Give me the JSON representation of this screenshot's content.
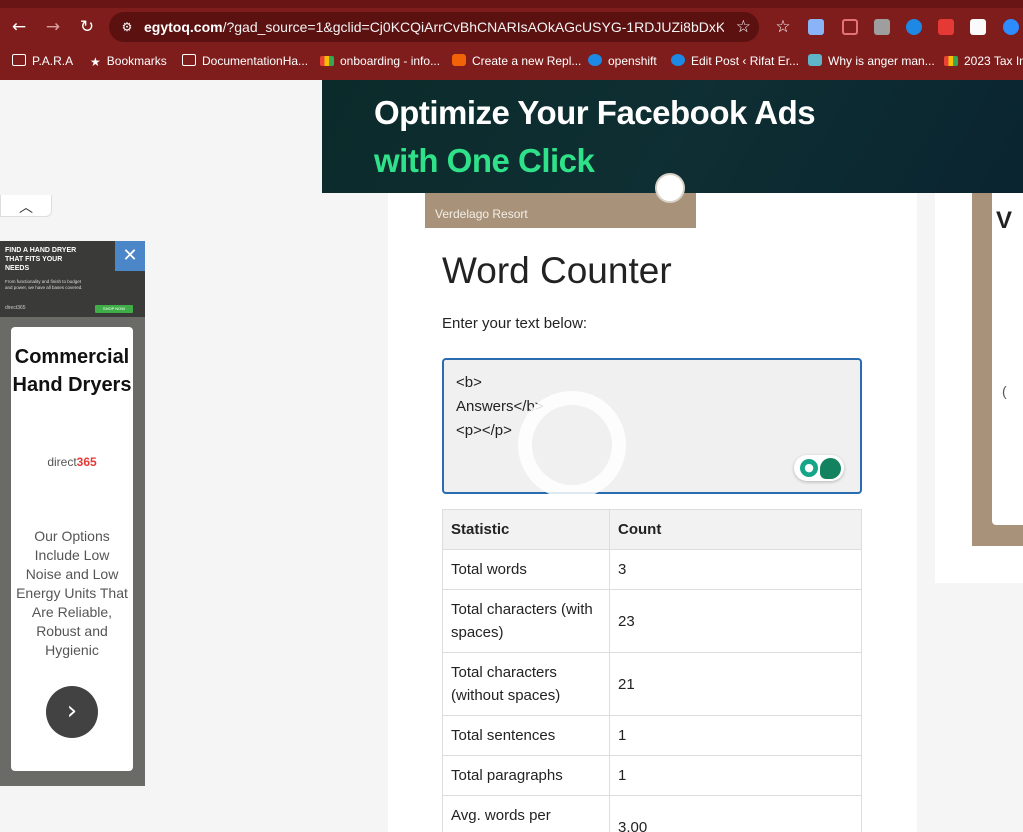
{
  "browser": {
    "url_domain": "egytoq.com",
    "url_rest": "/?gad_source=1&gclid=Cj0KCQiArrCvBhCNARIsAOkAGcUSYG-1RDJUZi8bDxKgDJ...",
    "nav": {
      "back": "←",
      "forward": "→",
      "reload": "↻"
    },
    "bookmarks": [
      {
        "label": "P.A.R.A",
        "icon": "folder-icon"
      },
      {
        "label": "Bookmarks",
        "icon": "star-icon"
      },
      {
        "label": "DocumentationHa...",
        "icon": "folder-icon"
      },
      {
        "label": "onboarding - info...",
        "icon": "gmail-icon"
      },
      {
        "label": "Create a new Repl...",
        "icon": "replit-icon"
      },
      {
        "label": "openshift",
        "icon": "wordpress-icon"
      },
      {
        "label": "Edit Post ‹ Rifat Er...",
        "icon": "wordpress-icon"
      },
      {
        "label": "Why is anger man...",
        "icon": "heart-icon"
      },
      {
        "label": "2023 Tax In",
        "icon": "gmail-icon"
      }
    ]
  },
  "banner_ad": {
    "line1": "Optimize Your Facebook Ads",
    "line2": "with One Click"
  },
  "side_ad": {
    "top_headline": "FIND A HAND DRYER THAT FITS YOUR NEEDS",
    "top_sub": "From functionality and finish to budget and power, we have all bases covered.",
    "top_shop": "SHOP NOW",
    "top_brand": "direct365",
    "close": "✕",
    "headline": "Commercial Hand Dryers",
    "brand_prefix": "direct",
    "brand_num": "365",
    "copy": "Our Options Include Low Noise and Low Energy Units That Are Reliable, Robust and Hygienic",
    "arrow": "›"
  },
  "content": {
    "resort_caption": "Verdelago Resort",
    "title": "Word Counter",
    "input_label": "Enter your text below:",
    "input_value": "<b>\nAnswers</b>\n<p></p>",
    "table": {
      "headers": [
        "Statistic",
        "Count"
      ],
      "rows": [
        [
          "Total words",
          "3"
        ],
        [
          "Total characters (with spaces)",
          "23"
        ],
        [
          "Total characters (without spaces)",
          "21"
        ],
        [
          "Total sentences",
          "1"
        ],
        [
          "Total paragraphs",
          "1"
        ],
        [
          "Avg. words per sentence",
          "3.00"
        ]
      ]
    }
  },
  "right_ad": {
    "letter": "V",
    "paren": "("
  },
  "colors": {
    "browser_frame": "#7f1d1d",
    "banner_green": "#2fe28a",
    "input_border": "#2b6cb0",
    "resort_tan": "#a8937a"
  }
}
